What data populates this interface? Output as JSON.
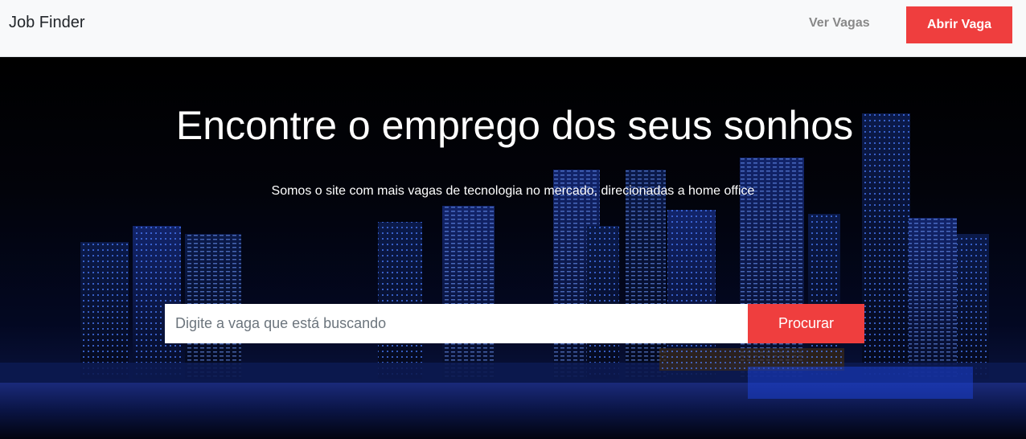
{
  "navbar": {
    "brand": "Job Finder",
    "links": [
      {
        "label": "Ver Vagas"
      }
    ],
    "cta_label": "Abrir Vaga"
  },
  "hero": {
    "title": "Encontre o emprego dos seus sonhos",
    "subtitle": "Somos o site com mais vagas de tecnologia no mercado, direcionadas a home office",
    "search": {
      "placeholder": "Digite a vaga que está buscando",
      "value": "",
      "button_label": "Procurar"
    }
  },
  "colors": {
    "accent": "#ef3e3e",
    "navbar_bg": "#f8f9fa",
    "hero_bg": "#000000"
  }
}
